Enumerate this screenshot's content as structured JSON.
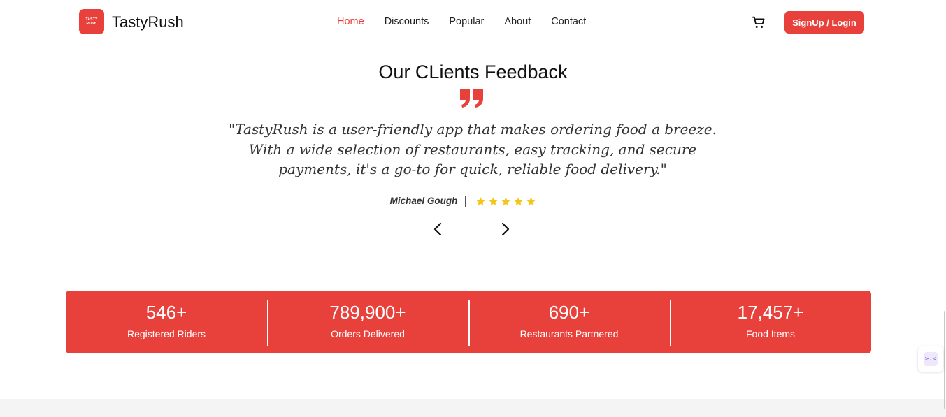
{
  "header": {
    "logo_lines": [
      "TASTY",
      "RUSH"
    ],
    "brand": "TastyRush",
    "nav": [
      {
        "label": "Home",
        "active": true
      },
      {
        "label": "Discounts",
        "active": false
      },
      {
        "label": "Popular",
        "active": false
      },
      {
        "label": "About",
        "active": false
      },
      {
        "label": "Contact",
        "active": false
      }
    ],
    "cart_icon": "shopping-cart-icon",
    "signup_label": "SignUp / Login"
  },
  "feedback": {
    "title": "Our CLients Feedback",
    "quote_icon": "quote-icon",
    "quote": "\"TastyRush is a user-friendly app that makes ordering food a breeze. With a wide selection of restaurants, easy tracking, and secure payments, it's a go-to for quick, reliable food delivery.\"",
    "author": "Michael Gough",
    "rating": 5,
    "prev_icon": "chevron-left-icon",
    "next_icon": "chevron-right-icon"
  },
  "stats": [
    {
      "value": "546+",
      "label": "Registered Riders"
    },
    {
      "value": "789,900+",
      "label": "Orders Delivered"
    },
    {
      "value": "690+",
      "label": "Restaurants Partnered"
    },
    {
      "value": "17,457+",
      "label": "Food Items"
    }
  ],
  "widget": {
    "glyph": ">.<"
  },
  "colors": {
    "accent": "#e8413b",
    "star": "#f5c518"
  }
}
